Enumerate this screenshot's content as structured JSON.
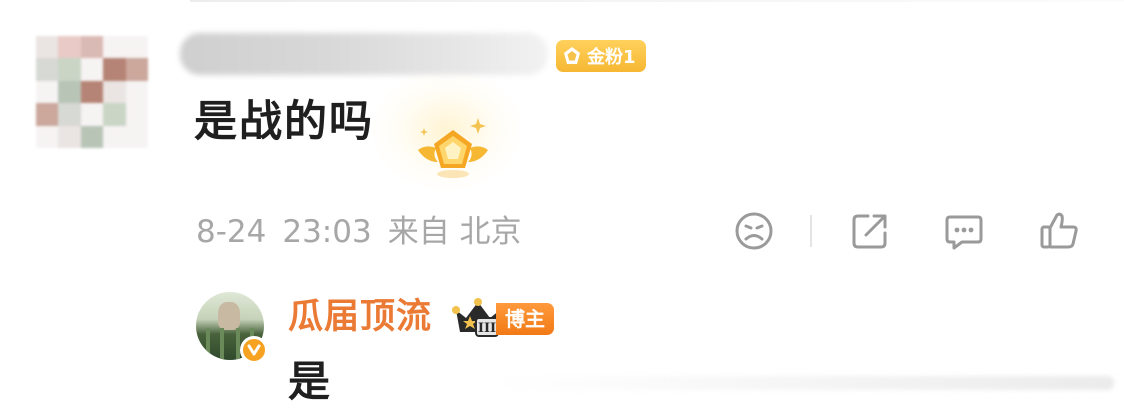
{
  "comment": {
    "avatar": "pixelated-avatar",
    "username": "",
    "fan_badge": {
      "icon": "gem-icon",
      "label": "金粉1"
    },
    "text": "是战的吗",
    "emblem": "winged-gem-emblem-icon",
    "meta": {
      "date": "8-24",
      "time": "23:03",
      "source": "来自 北京"
    },
    "actions": [
      {
        "name": "dislike-face-icon"
      },
      {
        "name": "share-icon"
      },
      {
        "name": "comment-icon"
      },
      {
        "name": "like-thumb-icon"
      }
    ]
  },
  "reply": {
    "avatar": "watermelon-avatar",
    "verified_icon": "verified-v-icon",
    "name": "瓜届顶流",
    "crown_badge": {
      "icon": "crown-icon",
      "level": "III"
    },
    "host_tag": "博主",
    "text": "是"
  },
  "colors": {
    "gold_badge": "#f6b733",
    "name_orange": "#eb7a34",
    "host_orange": "#f27a16",
    "meta_gray": "#a7a7a7",
    "text_dark": "#1f1f1f"
  }
}
